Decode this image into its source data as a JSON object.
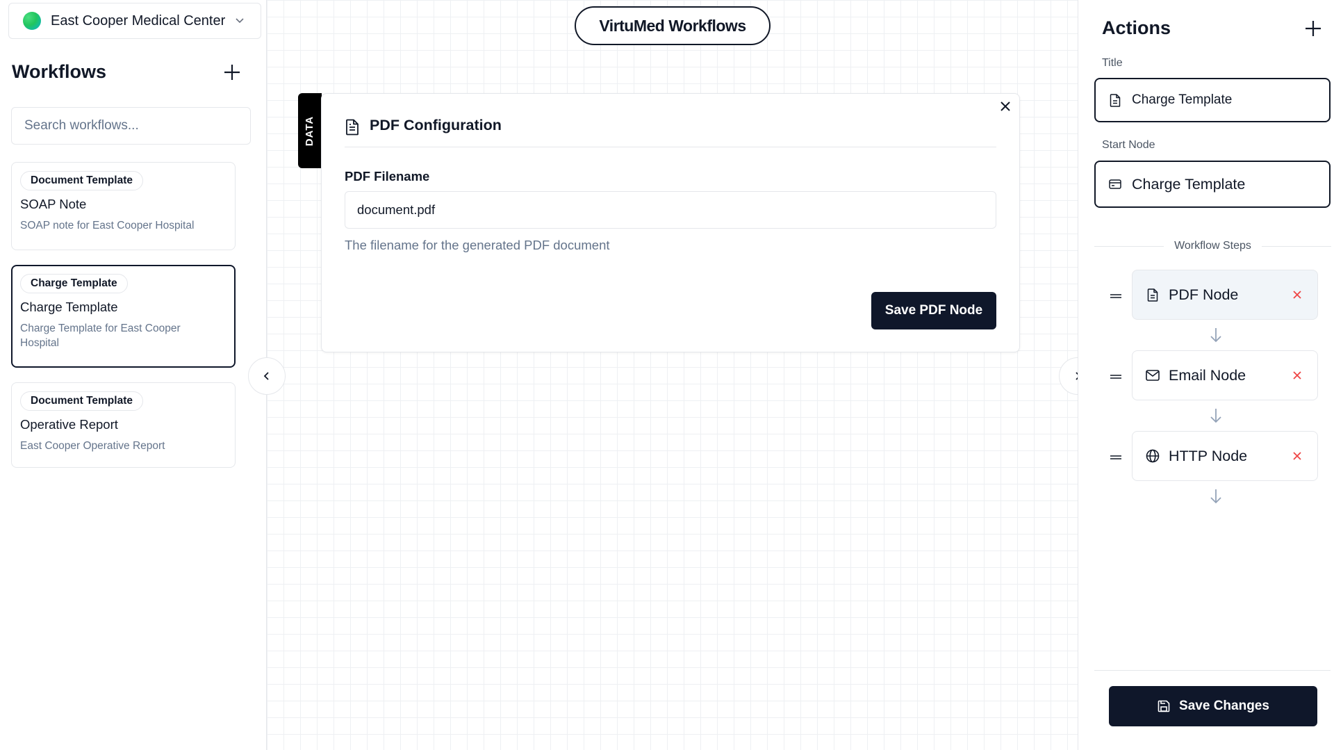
{
  "app": {
    "title": "VirtuMed Workflows"
  },
  "org": {
    "name": "East Cooper Medical Center"
  },
  "left_sidebar": {
    "heading": "Workflows",
    "search_placeholder": "Search workflows...",
    "workflows": [
      {
        "badge": "Document Template",
        "title": "SOAP Note",
        "description": "SOAP note for East Cooper Hospital",
        "selected": false
      },
      {
        "badge": "Charge Template",
        "title": "Charge Template",
        "description": "Charge Template for East Cooper Hospital",
        "selected": true
      },
      {
        "badge": "Document Template",
        "title": "Operative Report",
        "description": "East Cooper Operative Report",
        "selected": false
      }
    ]
  },
  "canvas": {
    "data_tab_label": "DATA",
    "pdf_panel": {
      "title": "PDF Configuration",
      "filename_label": "PDF Filename",
      "filename_value": "document.pdf",
      "filename_help": "The filename for the generated PDF document",
      "save_label": "Save PDF Node"
    }
  },
  "right_sidebar": {
    "heading": "Actions",
    "title_label": "Title",
    "title_value": "Charge Template",
    "start_node_label": "Start Node",
    "start_node_value": "Charge Template",
    "steps_label": "Workflow Steps",
    "steps": [
      {
        "label": "PDF Node",
        "icon": "file-icon",
        "active": true
      },
      {
        "label": "Email Node",
        "icon": "mail-icon",
        "active": false
      },
      {
        "label": "HTTP Node",
        "icon": "globe-icon",
        "active": false
      }
    ],
    "save_label": "Save Changes"
  },
  "colors": {
    "primary": "#0f172a",
    "muted_text": "#64748b",
    "danger": "#ef4444",
    "border": "#e5e7eb"
  }
}
